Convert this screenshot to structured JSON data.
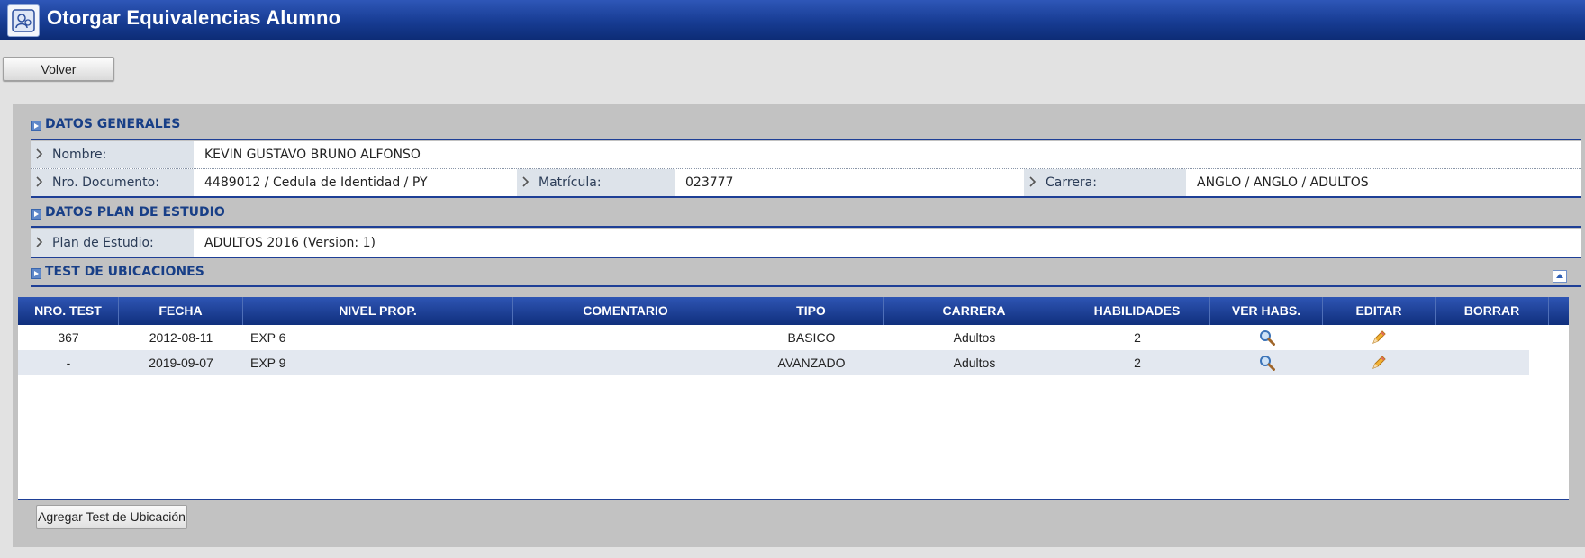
{
  "app": {
    "title": "Otorgar Equivalencias Alumno"
  },
  "toolbar": {
    "back_label": "Volver"
  },
  "datos_generales": {
    "title": "DATOS GENERALES",
    "nombre_label": "Nombre:",
    "nombre_value": "KEVIN GUSTAVO BRUNO ALFONSO",
    "documento_label": "Nro. Documento:",
    "documento_value": "4489012 / Cedula de Identidad / PY",
    "matricula_label": "Matrícula:",
    "matricula_value": "023777",
    "carrera_label": "Carrera:",
    "carrera_value": "ANGLO / ANGLO / ADULTOS"
  },
  "plan_estudio": {
    "title": "DATOS PLAN DE ESTUDIO",
    "plan_label": "Plan de Estudio:",
    "plan_value": "ADULTOS 2016 (Version: 1)"
  },
  "test_ubicaciones": {
    "title": "TEST DE UBICACIONES",
    "columns": [
      "NRO. TEST",
      "FECHA",
      "NIVEL PROP.",
      "COMENTARIO",
      "TIPO",
      "CARRERA",
      "HABILIDADES",
      "VER HABS.",
      "EDITAR",
      "BORRAR"
    ],
    "rows": [
      {
        "nro": "367",
        "fecha": "2012-08-11",
        "nivel": "EXP 6",
        "comentario": "",
        "tipo": "BASICO",
        "carrera": "Adultos",
        "habilidades": "2",
        "ver_icon": "magnifier-icon",
        "editar_icon": "pencil-icon"
      },
      {
        "nro": "-",
        "fecha": "2019-09-07",
        "nivel": "EXP 9",
        "comentario": "",
        "tipo": "AVANZADO",
        "carrera": "Adultos",
        "habilidades": "2",
        "ver_icon": "magnifier-icon",
        "editar_icon": "pencil-icon"
      }
    ],
    "add_button_label": "Agregar Test de Ubicación"
  },
  "colors": {
    "titlebar": "#173c93",
    "section_title": "#183f87",
    "label_bg": "#dde3ea",
    "alt_row": "#e3e8f0"
  }
}
